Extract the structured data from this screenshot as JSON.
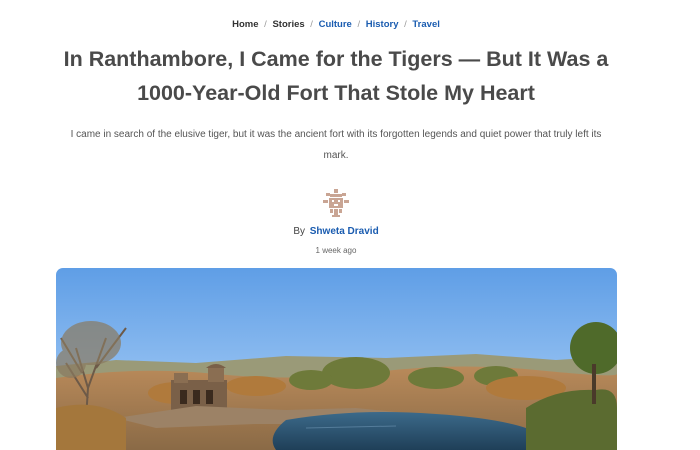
{
  "breadcrumb": {
    "home": "Home",
    "stories": "Stories",
    "culture": "Culture",
    "history": "History",
    "travel": "Travel",
    "separator": "/"
  },
  "article": {
    "title": "In Ranthambore, I Came for the Tigers — But It Was a 1000-Year-Old Fort That Stole My Heart",
    "subtitle": "I came in search of the elusive tiger, but it was the ancient fort with its forgotten legends and quiet power that truly left its mark.",
    "byline_prefix": "By",
    "author": "Shweta Dravid",
    "date": "1 week ago",
    "avatar_icon": "ornamental-avatar-icon",
    "hero_image": "fort-lake-landscape-photo"
  },
  "colors": {
    "link": "#1a5cb0",
    "title": "#4a4a4a",
    "avatar": "#c9a594"
  }
}
